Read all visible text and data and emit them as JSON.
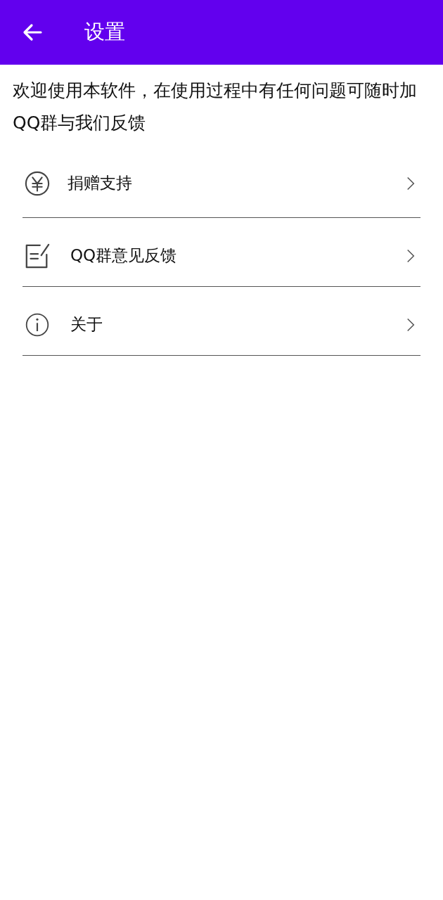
{
  "app_bar": {
    "title": "设置"
  },
  "intro": "欢迎使用本软件，在使用过程中有任何问题可随时加QQ群与我们反馈",
  "items": [
    {
      "label": "捐赠支持"
    },
    {
      "label": "QQ群意见反馈"
    },
    {
      "label": "关于"
    }
  ]
}
